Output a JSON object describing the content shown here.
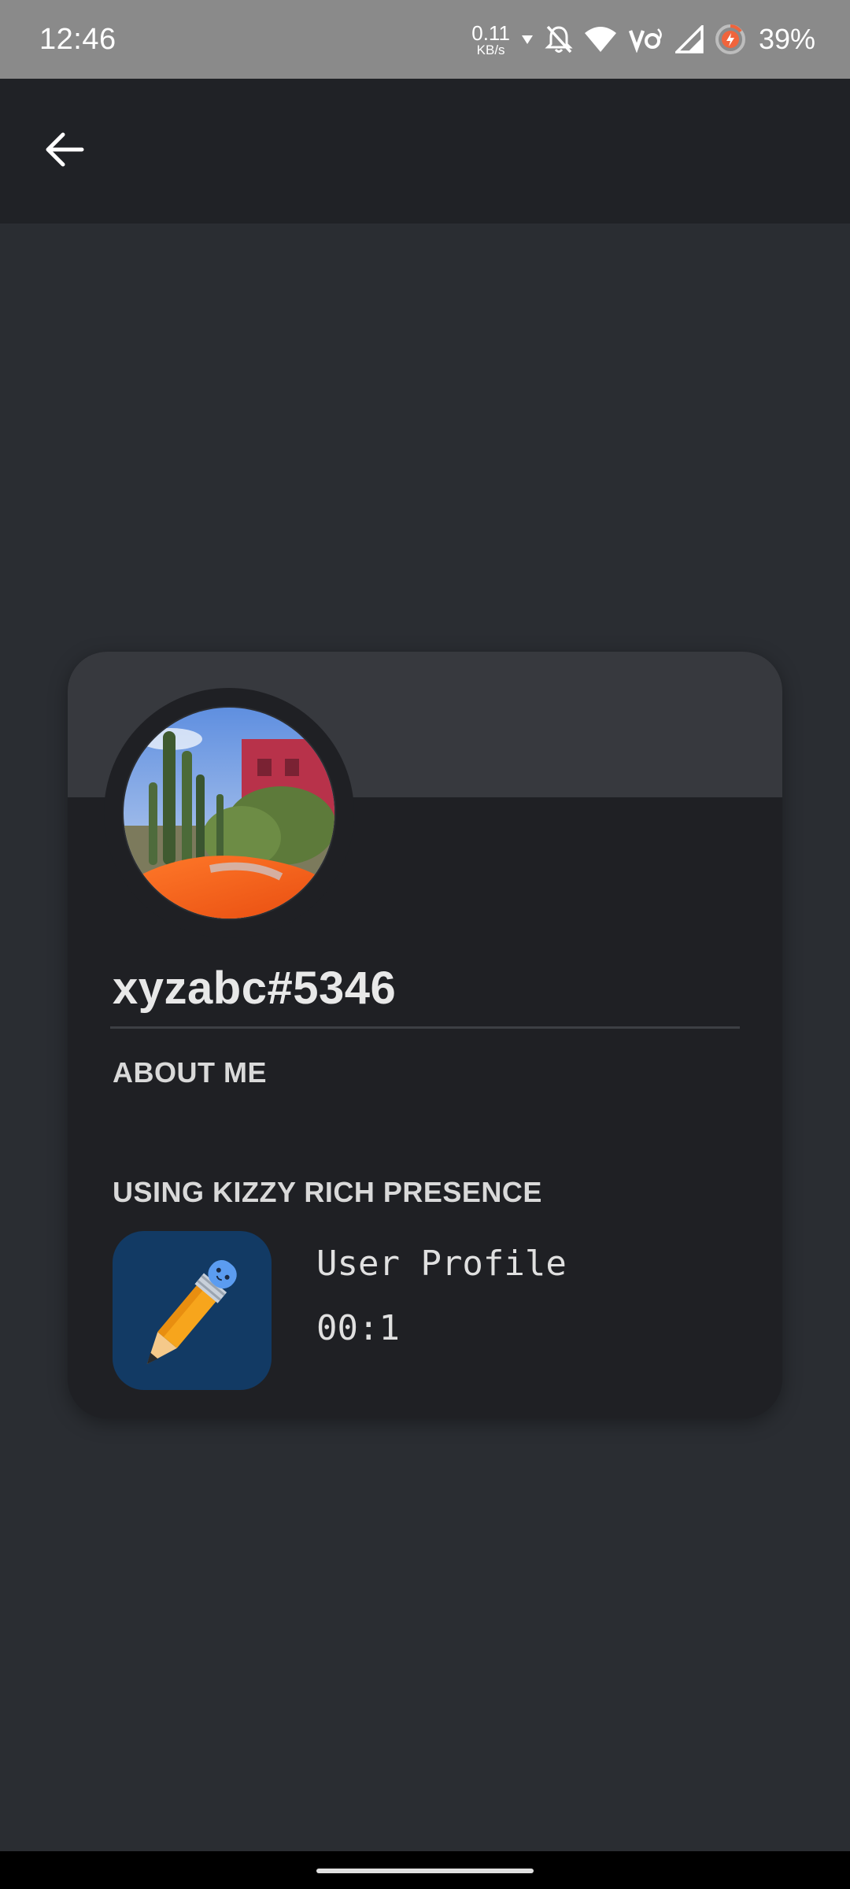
{
  "status_bar": {
    "time": "12:46",
    "net_speed_value": "0.11",
    "net_speed_unit": "KB/s",
    "battery_percent": "39%",
    "icons": [
      "download-arrow-icon",
      "bell-off-icon",
      "wifi-icon",
      "volte-icon",
      "signal-icon",
      "battery-saver-icon"
    ]
  },
  "app_bar": {
    "back_icon": "arrow-left-icon"
  },
  "profile": {
    "username": "xyzabc#5346",
    "about_label": "ABOUT ME",
    "presence_label": "USING KIZZY RICH PRESENCE",
    "activity_title": "User Profile",
    "activity_time": "00:1"
  },
  "colors": {
    "background": "#2a2d32",
    "app_bar": "#202226",
    "card": "#1f2024",
    "banner": "#37393e",
    "app_icon_bg": "#123a64"
  }
}
